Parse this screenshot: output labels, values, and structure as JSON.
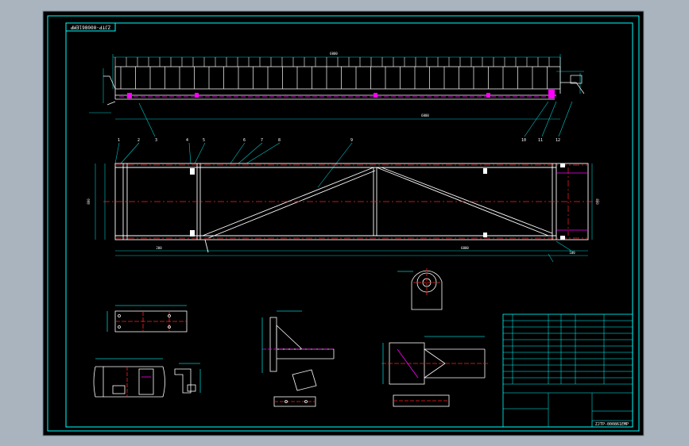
{
  "drawing": {
    "code_top": "ZJTP-000861EMP",
    "code_bottom": "ZJTP-000861EMP",
    "part_numbers": [
      "1",
      "2",
      "3",
      "4",
      "5",
      "6",
      "7",
      "8",
      "9",
      "10",
      "11",
      "12"
    ],
    "dim_short": "200",
    "dim_total": "6000",
    "dim_right": "100",
    "dim_height": "800",
    "colors": {
      "background": "#000000",
      "frame": "#00ffff",
      "structure": "#ffffff",
      "accent": "#ff00ff",
      "hidden": "#ff2020",
      "dimension": "#00c8c8"
    }
  }
}
